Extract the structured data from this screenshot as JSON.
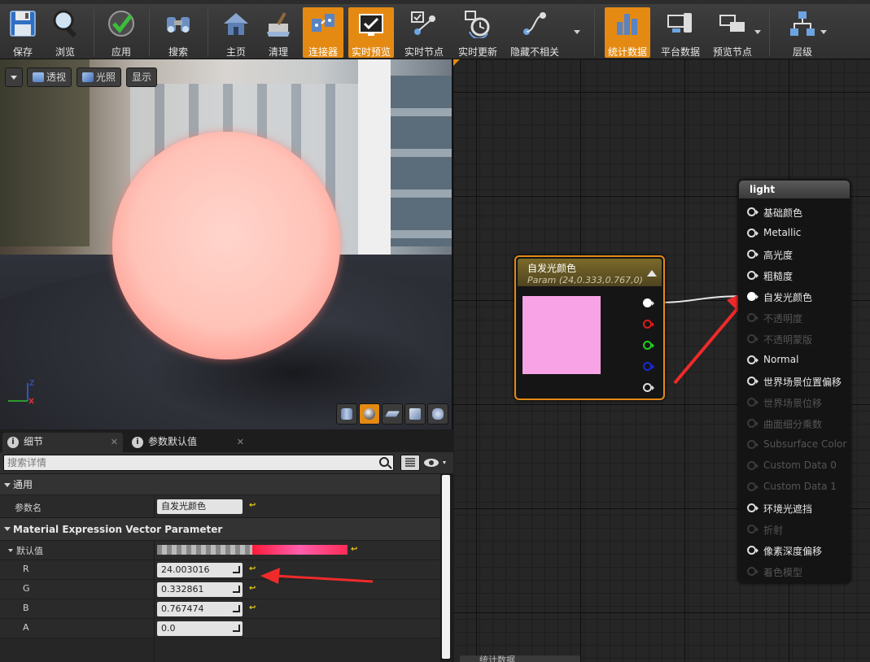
{
  "toolbar": {
    "buttons": [
      {
        "label": "保存",
        "icon": "floppy-disk-icon",
        "active": false
      },
      {
        "label": "浏览",
        "icon": "magnifier-icon",
        "active": false
      },
      {
        "label": "应用",
        "icon": "checkmark-icon",
        "active": false
      },
      {
        "label": "搜索",
        "icon": "binoculars-icon",
        "active": false
      },
      {
        "label": "主页",
        "icon": "home-icon",
        "active": false
      },
      {
        "label": "清理",
        "icon": "broom-icon",
        "active": false
      },
      {
        "label": "连接器",
        "icon": "connectors-icon",
        "active": true
      },
      {
        "label": "实时预览",
        "icon": "live-preview-icon",
        "active": true
      },
      {
        "label": "实时节点",
        "icon": "live-nodes-icon",
        "active": false
      },
      {
        "label": "实时更新",
        "icon": "live-update-icon",
        "active": false
      },
      {
        "label": "隐藏不相关",
        "icon": "hide-unrelated-icon",
        "active": false
      },
      {
        "label": "统计数据",
        "icon": "stats-icon",
        "active": true
      },
      {
        "label": "平台数据",
        "icon": "platform-stats-icon",
        "active": false
      },
      {
        "label": "预览节点",
        "icon": "preview-node-icon",
        "active": false
      },
      {
        "label": "层级",
        "icon": "hierarchy-icon",
        "active": false
      }
    ]
  },
  "viewport": {
    "perspective_label": "透视",
    "lighting_label": "光照",
    "show_label": "显示",
    "axis_z": "Z"
  },
  "details": {
    "tab_details": "细节",
    "tab_param_defaults": "参数默认值",
    "search_placeholder": "搜索详情",
    "category_general": "通用",
    "param_name_label": "参数名",
    "param_name_value": "自发光颜色",
    "category_mevp": "Material Expression Vector Parameter",
    "default_value_label": "默认值",
    "channels": [
      {
        "label": "R",
        "value": "24.003016",
        "reset": true
      },
      {
        "label": "G",
        "value": "0.332861",
        "reset": true
      },
      {
        "label": "B",
        "value": "0.767474",
        "reset": true
      },
      {
        "label": "A",
        "value": "0.0",
        "reset": false
      }
    ]
  },
  "param_node": {
    "title": "自发光颜色",
    "subtitle": "Param (24,0.333,0.767,0)",
    "swatch_color": "#f7a3e6"
  },
  "material_node": {
    "title": "light",
    "inputs": [
      {
        "label": "基础颜色",
        "enabled": true
      },
      {
        "label": "Metallic",
        "enabled": true
      },
      {
        "label": "高光度",
        "enabled": true
      },
      {
        "label": "粗糙度",
        "enabled": true
      },
      {
        "label": "自发光颜色",
        "enabled": true,
        "connected": true
      },
      {
        "label": "不透明度",
        "enabled": false
      },
      {
        "label": "不透明蒙版",
        "enabled": false
      },
      {
        "label": "Normal",
        "enabled": true
      },
      {
        "label": "世界场景位置偏移",
        "enabled": true
      },
      {
        "label": "世界场景位移",
        "enabled": false
      },
      {
        "label": "曲面细分乘数",
        "enabled": false
      },
      {
        "label": "Subsurface Color",
        "enabled": false
      },
      {
        "label": "Custom Data 0",
        "enabled": false
      },
      {
        "label": "Custom Data 1",
        "enabled": false
      },
      {
        "label": "环境光遮挡",
        "enabled": true
      },
      {
        "label": "折射",
        "enabled": false
      },
      {
        "label": "像素深度偏移",
        "enabled": true
      },
      {
        "label": "着色模型",
        "enabled": false
      }
    ]
  },
  "colors": {
    "accent": "#e48a13",
    "annotation_arrow": "#f02a2a"
  }
}
